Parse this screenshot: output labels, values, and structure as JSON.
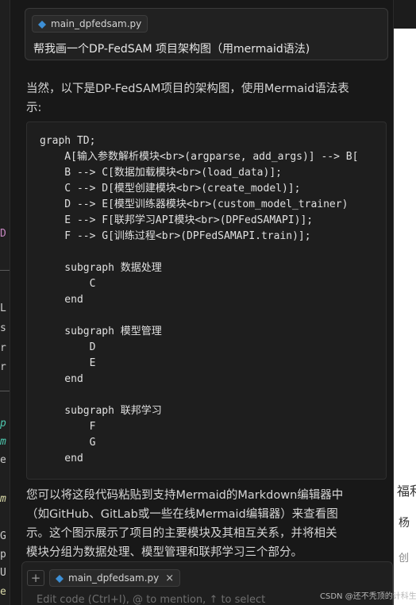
{
  "chat": {
    "user_message": {
      "file_chip": "main_dpfedsam.py",
      "text": "帮我画一个DP-FedSAM 项目架构图（用mermaid语法)"
    },
    "assistant": {
      "intro_line1": "当然，以下是DP-FedSAM项目的架构图，使用Mermaid语法表",
      "intro_line2": "示:",
      "code": "graph TD;\n    A[输入参数解析模块<br>(argparse, add_args)] --> B[\n    B --> C[数据加载模块<br>(load_data)];\n    C --> D[模型创建模块<br>(create_model)];\n    D --> E[模型训练器模块<br>(custom_model_trainer)\n    E --> F[联邦学习API模块<br>(DPFedSAMAPI)];\n    F --> G[训练过程<br>(DPFedSAMAPI.train)];\n\n    subgraph 数据处理\n        C\n    end\n\n    subgraph 模型管理\n        D\n        E\n    end\n\n    subgraph 联邦学习\n        F\n        G\n    end",
      "outro": [
        "您可以将这段代码粘贴到支持Mermaid的Markdown编辑器中",
        "（如GitHub、GitLab或一些在线Mermaid编辑器）来查看图",
        "示。这个图示展示了项目的主要模块及其相互关系，并将相关",
        "模块分组为数据处理、模型管理和联邦学习三个部分。"
      ]
    }
  },
  "composer": {
    "plus": "+",
    "file_chip": "main_dpfedsam.py",
    "close": "×",
    "placeholder": "Edit code (Ctrl+I), @ to mention, ↑ to select"
  },
  "left_gutter": {
    "glyphs": [
      "D",
      "L",
      "s",
      "r",
      "r",
      "p",
      "m",
      "e",
      "m",
      "G",
      "p",
      "U",
      "e"
    ]
  },
  "right_strip": {
    "texts": [
      "福利",
      "杨",
      "创"
    ]
  },
  "watermark": "CSDN @还不秃顶的计科生",
  "colors": {
    "panel_bg": "#181818",
    "code_bg": "#1e1e1e",
    "python_icon": "#3d8fd6"
  }
}
